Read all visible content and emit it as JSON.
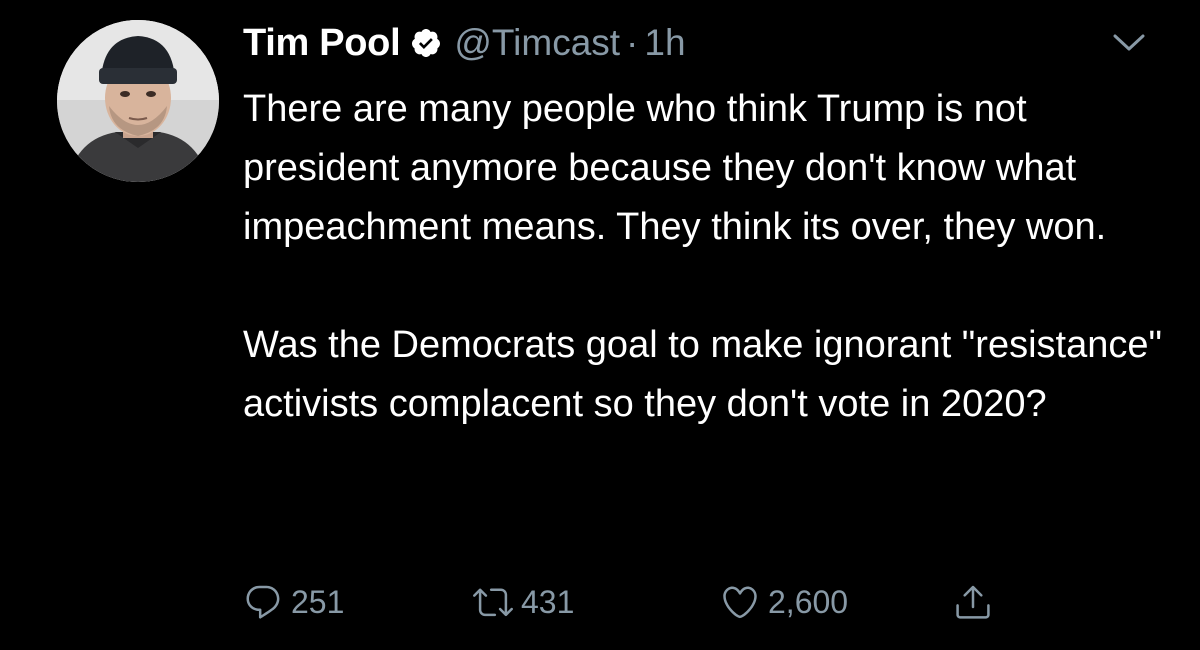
{
  "tweet": {
    "author": {
      "name": "Tim Pool",
      "handle": "@Timcast",
      "verified": true,
      "avatar_icon": "avatar-photo"
    },
    "separator": "·",
    "timestamp": "1h",
    "menu_icon": "chevron-down-icon",
    "paragraphs": [
      "There are many people who think Trump is not president anymore because they don't know what impeachment means. They think its over, they won.",
      "Was the Democrats goal to make ignorant \"resistance\" activists complacent so they don't vote in 2020?"
    ],
    "actions": {
      "reply": {
        "icon": "reply-icon",
        "count": "251"
      },
      "retweet": {
        "icon": "retweet-icon",
        "count": "431"
      },
      "like": {
        "icon": "heart-icon",
        "count": "2,600"
      },
      "share": {
        "icon": "share-icon"
      }
    }
  },
  "colors": {
    "background": "#000000",
    "text_primary": "#ffffff",
    "text_secondary": "#8899a6"
  }
}
